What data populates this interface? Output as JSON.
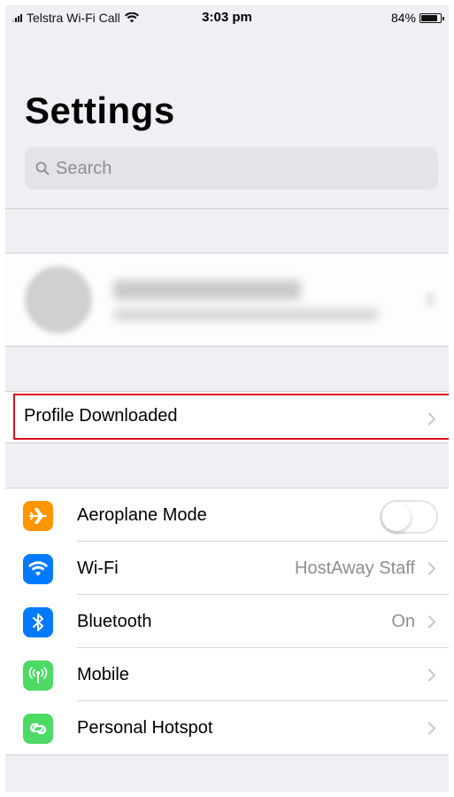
{
  "status_bar": {
    "carrier": "Telstra Wi-Fi Call",
    "time": "3:03 pm",
    "battery": "84%",
    "battery_level": 0.84
  },
  "header": {
    "title": "Settings"
  },
  "search": {
    "placeholder": "Search"
  },
  "profile_downloaded": {
    "label": "Profile Downloaded",
    "highlight_color": "#d6111c"
  },
  "settings": [
    {
      "label": "Aeroplane Mode",
      "icon": "airplane-icon",
      "icon_color": "#ff9500",
      "control": "toggle",
      "on": false
    },
    {
      "label": "Wi-Fi",
      "icon": "wifi-icon",
      "icon_color": "#007aff",
      "value": "HostAway Staff"
    },
    {
      "label": "Bluetooth",
      "icon": "bluetooth-icon",
      "icon_color": "#007aff",
      "value": "On"
    },
    {
      "label": "Mobile",
      "icon": "antenna-icon",
      "icon_color": "#4cd964"
    },
    {
      "label": "Personal Hotspot",
      "icon": "hotspot-icon",
      "icon_color": "#4cd964"
    }
  ]
}
